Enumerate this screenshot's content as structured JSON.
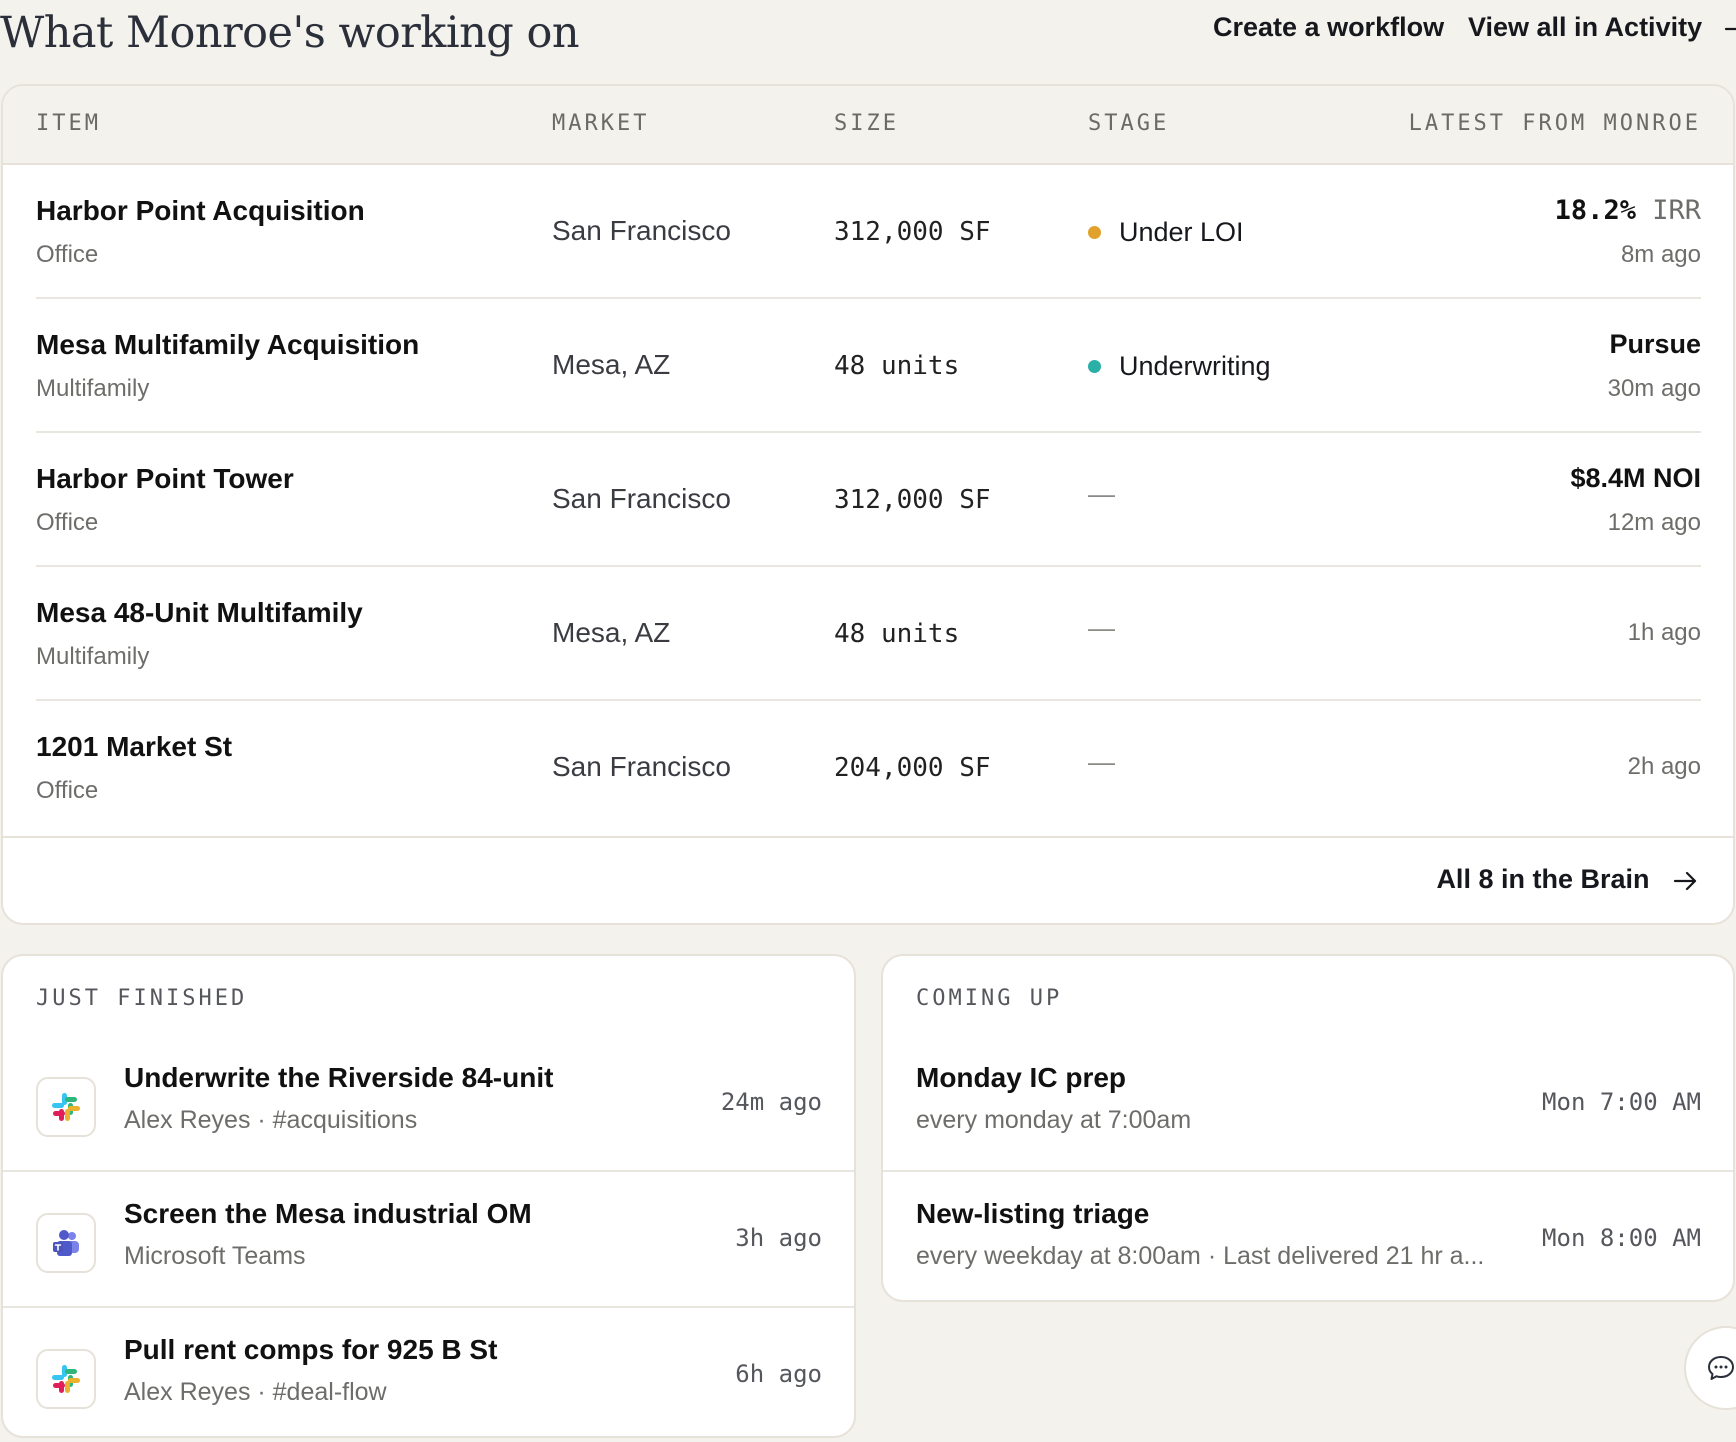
{
  "header": {
    "title": "What Monroe's working on",
    "create_workflow": "Create a workflow",
    "view_all": "View all in Activity"
  },
  "table": {
    "columns": [
      "ITEM",
      "MARKET",
      "SIZE",
      "STAGE",
      "LATEST FROM MONROE"
    ],
    "rows": [
      {
        "name": "Harbor Point Acquisition",
        "type": "Office",
        "market": "San Francisco",
        "size": "312,000 SF",
        "stage": "Under LOI",
        "stage_color": "#e0a22c",
        "latest_value": "18.2%",
        "latest_unit": "IRR",
        "latest_time": "8m ago"
      },
      {
        "name": "Mesa Multifamily Acquisition",
        "type": "Multifamily",
        "market": "Mesa, AZ",
        "size": "48 units",
        "stage": "Underwriting",
        "stage_color": "#2ab0a6",
        "latest_main": "Pursue",
        "latest_time": "30m ago"
      },
      {
        "name": "Harbor Point Tower",
        "type": "Office",
        "market": "San Francisco",
        "size": "312,000 SF",
        "stage": "—",
        "latest_main": "$8.4M NOI",
        "latest_time": "12m ago"
      },
      {
        "name": "Mesa 48-Unit Multifamily",
        "type": "Multifamily",
        "market": "Mesa, AZ",
        "size": "48 units",
        "stage": "—",
        "latest_time": "1h ago"
      },
      {
        "name": "1201 Market St",
        "type": "Office",
        "market": "San Francisco",
        "size": "204,000 SF",
        "stage": "—",
        "latest_time": "2h ago"
      }
    ],
    "footer_link": "All 8 in the Brain"
  },
  "just_finished": {
    "title": "JUST FINISHED",
    "items": [
      {
        "title": "Underwrite the Riverside 84-unit",
        "subtitle": "Alex Reyes · #acquisitions",
        "time": "24m ago",
        "icon": "slack-icon"
      },
      {
        "title": "Screen the Mesa industrial OM",
        "subtitle": "Microsoft Teams",
        "time": "3h ago",
        "icon": "teams-icon"
      },
      {
        "title": "Pull rent comps for 925 B St",
        "subtitle": "Alex Reyes · #deal-flow",
        "time": "6h ago",
        "icon": "slack-icon"
      }
    ]
  },
  "coming_up": {
    "title": "COMING UP",
    "items": [
      {
        "title": "Monday IC prep",
        "subtitle": "every monday at 7:00am",
        "time": "Mon 7:00 AM"
      },
      {
        "title": "New-listing triage",
        "subtitle": "every weekday at 8:00am · Last delivered 21 hr a...",
        "time": "Mon 8:00 AM"
      }
    ]
  },
  "colors": {
    "background": "#f4f2ed",
    "card": "#ffffff",
    "border": "#e6e2d9",
    "under_loi": "#e0a22c",
    "underwriting": "#2ab0a6"
  }
}
